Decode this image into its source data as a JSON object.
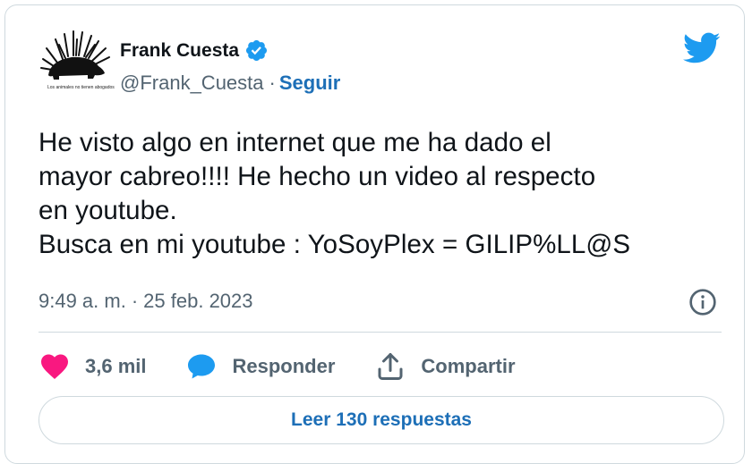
{
  "author": {
    "display_name": "Frank Cuesta",
    "handle": "@Frank_Cuesta",
    "separator": "·",
    "follow_label": "Seguir",
    "avatar_caption": "Los animales no tienen abogados",
    "verified_icon": "verified-badge-icon"
  },
  "tweet": {
    "text": "He visto algo en internet que me ha dado el\nmayor cabreo!!!! He hecho un video al respecto\nen youtube.\nBusca en mi youtube : YoSoyPlex = GILIP%LL@S",
    "time": "9:49 a. m.",
    "date_separator": "·",
    "date": "25 feb. 2023"
  },
  "actions": {
    "likes_label": "3,6 mil",
    "reply_label": "Responder",
    "share_label": "Compartir"
  },
  "read_replies_label": "Leer 130 respuestas",
  "colors": {
    "twitter_blue": "#1d9bf0",
    "link_blue": "#1d6fb7",
    "heart_pink": "#f91880",
    "text_secondary": "#536471",
    "border": "#cfd9de"
  },
  "icons": [
    "twitter-bird-icon",
    "info-icon",
    "heart-icon",
    "reply-bubble-icon",
    "share-icon"
  ]
}
